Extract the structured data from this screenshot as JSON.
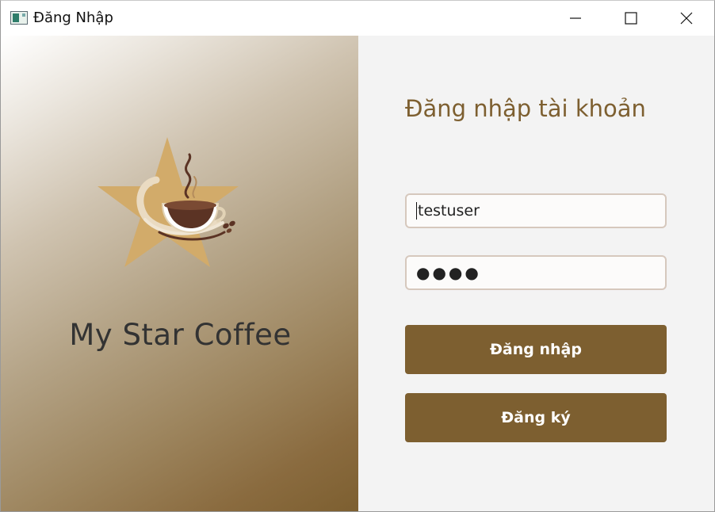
{
  "window": {
    "title": "Đăng Nhập",
    "icon": "app-window-icon",
    "controls": [
      "minimize-icon",
      "maximize-icon",
      "close-icon"
    ]
  },
  "brand": {
    "logo_icon": "star-coffee-cup-logo",
    "name": "My Star Coffee"
  },
  "login": {
    "heading": "Đăng nhập tài khoản",
    "username_value": "testuser",
    "password_masked": "●●●●",
    "login_label": "Đăng nhập",
    "register_label": "Đăng ký"
  },
  "colors": {
    "accent": "#7d5f30",
    "heading": "#7d5f30",
    "star": "#d2ab6a",
    "field_border": "#d6c8bd"
  }
}
